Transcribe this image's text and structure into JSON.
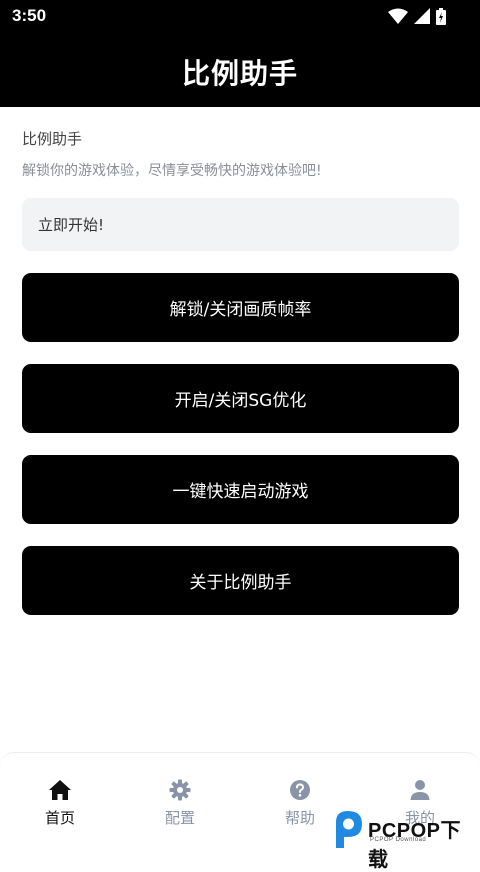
{
  "status_bar": {
    "time": "3:50"
  },
  "header": {
    "title": "比例助手"
  },
  "main": {
    "section_title": "比例助手",
    "subtitle": "解锁你的游戏体验，尽情享受畅快的游戏体验吧!",
    "start_label": "立即开始!",
    "buttons": [
      {
        "label": "解锁/关闭画质帧率"
      },
      {
        "label": "开启/关闭SG优化"
      },
      {
        "label": "一键快速启动游戏"
      },
      {
        "label": "关于比例助手"
      }
    ]
  },
  "tabs": [
    {
      "label": "首页",
      "icon": "home-icon",
      "active": true
    },
    {
      "label": "配置",
      "icon": "gear-icon",
      "active": false
    },
    {
      "label": "帮助",
      "icon": "help-icon",
      "active": false
    },
    {
      "label": "我的",
      "icon": "user-icon",
      "active": false
    }
  ],
  "watermark": {
    "brand": "PCPOP下载",
    "sub": "PCPOP Download"
  },
  "colors": {
    "accent": "#000000",
    "tab_inactive": "#8a94a8",
    "input_bg": "#f2f3f5"
  }
}
